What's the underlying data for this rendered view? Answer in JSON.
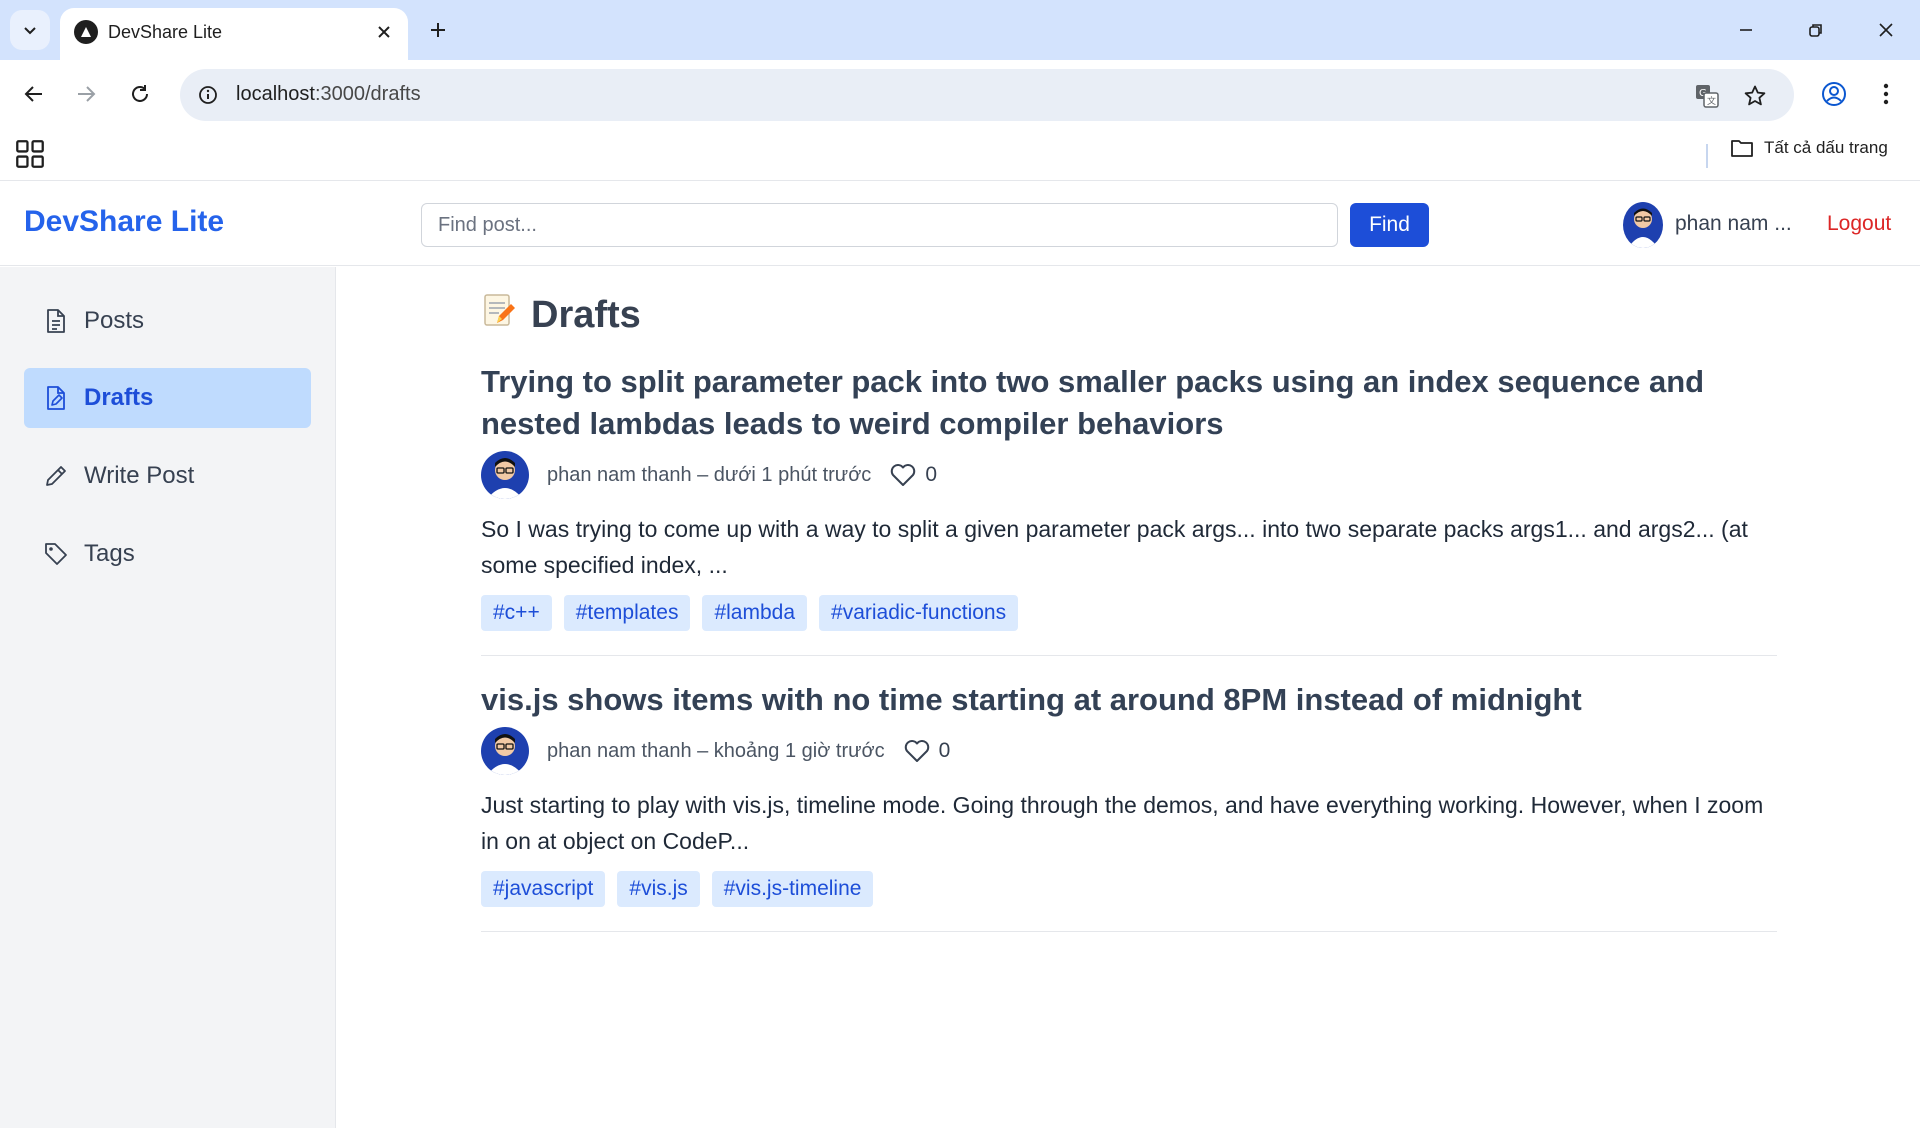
{
  "browser": {
    "tab_title": "DevShare Lite",
    "url_host": "localhost",
    "url_path": ":3000/drafts",
    "bookmarks_all_label": "Tất cả dấu trang"
  },
  "header": {
    "brand": "DevShare Lite",
    "search_placeholder": "Find post...",
    "find_label": "Find",
    "user_name": "phan nam ...",
    "logout_label": "Logout"
  },
  "sidebar": {
    "items": [
      {
        "label": "Posts",
        "icon": "document-icon",
        "active": false
      },
      {
        "label": "Drafts",
        "icon": "edit-document-icon",
        "active": true
      },
      {
        "label": "Write Post",
        "icon": "pencil-icon",
        "active": false
      },
      {
        "label": "Tags",
        "icon": "tag-icon",
        "active": false
      }
    ]
  },
  "main": {
    "title": "Drafts",
    "title_icon": "memo-icon",
    "posts": [
      {
        "title": "Trying to split parameter pack into two smaller packs using an index sequence and nested lambdas leads to weird compiler behaviors",
        "meta": "phan nam thanh – dưới 1 phút trước",
        "likes": "0",
        "excerpt": "So I was trying to come up with a way to split a given parameter pack args... into two separate packs args1... and args2... (at some specified index, ...",
        "tags": [
          "#c++",
          "#templates",
          "#lambda",
          "#variadic-functions"
        ]
      },
      {
        "title": "vis.js shows items with no time starting at around 8PM instead of midnight",
        "meta": "phan nam thanh – khoảng 1 giờ trước",
        "likes": "0",
        "excerpt": "Just starting to play with vis.js, timeline mode. Going through the demos, and have everything working. However, when I zoom in on at object on CodeP...",
        "tags": [
          "#javascript",
          "#vis.js",
          "#vis.js-timeline"
        ]
      }
    ]
  },
  "colors": {
    "brand": "#2563eb",
    "find_button": "#1d4ed8",
    "logout": "#dc2626",
    "active_sidebar_bg": "#bfdbfe",
    "tag_bg": "#dbeafe"
  }
}
